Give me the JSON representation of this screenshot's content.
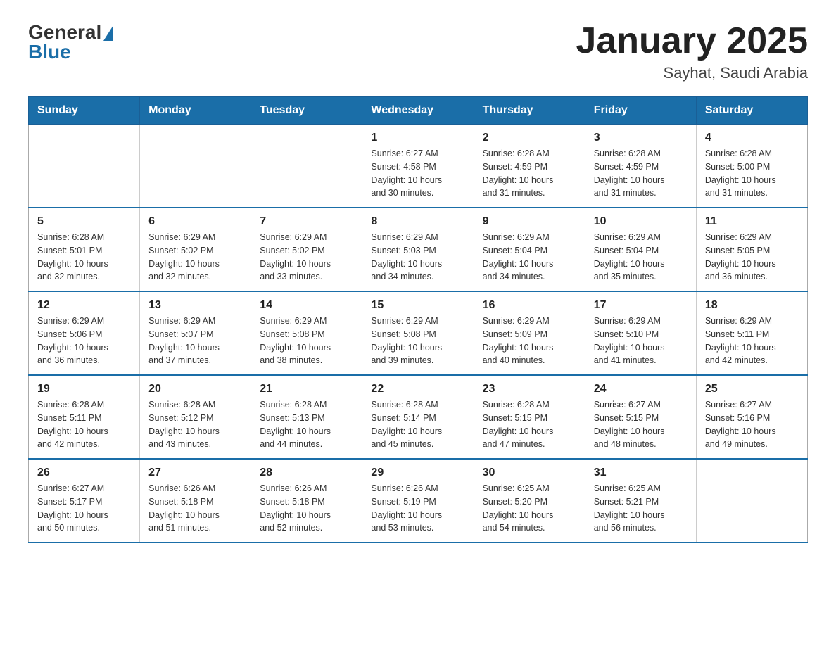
{
  "header": {
    "logo_general": "General",
    "logo_blue": "Blue",
    "title": "January 2025",
    "subtitle": "Sayhat, Saudi Arabia"
  },
  "weekdays": [
    "Sunday",
    "Monday",
    "Tuesday",
    "Wednesday",
    "Thursday",
    "Friday",
    "Saturday"
  ],
  "weeks": [
    [
      {
        "day": null,
        "info": null
      },
      {
        "day": null,
        "info": null
      },
      {
        "day": null,
        "info": null
      },
      {
        "day": "1",
        "info": "Sunrise: 6:27 AM\nSunset: 4:58 PM\nDaylight: 10 hours\nand 30 minutes."
      },
      {
        "day": "2",
        "info": "Sunrise: 6:28 AM\nSunset: 4:59 PM\nDaylight: 10 hours\nand 31 minutes."
      },
      {
        "day": "3",
        "info": "Sunrise: 6:28 AM\nSunset: 4:59 PM\nDaylight: 10 hours\nand 31 minutes."
      },
      {
        "day": "4",
        "info": "Sunrise: 6:28 AM\nSunset: 5:00 PM\nDaylight: 10 hours\nand 31 minutes."
      }
    ],
    [
      {
        "day": "5",
        "info": "Sunrise: 6:28 AM\nSunset: 5:01 PM\nDaylight: 10 hours\nand 32 minutes."
      },
      {
        "day": "6",
        "info": "Sunrise: 6:29 AM\nSunset: 5:02 PM\nDaylight: 10 hours\nand 32 minutes."
      },
      {
        "day": "7",
        "info": "Sunrise: 6:29 AM\nSunset: 5:02 PM\nDaylight: 10 hours\nand 33 minutes."
      },
      {
        "day": "8",
        "info": "Sunrise: 6:29 AM\nSunset: 5:03 PM\nDaylight: 10 hours\nand 34 minutes."
      },
      {
        "day": "9",
        "info": "Sunrise: 6:29 AM\nSunset: 5:04 PM\nDaylight: 10 hours\nand 34 minutes."
      },
      {
        "day": "10",
        "info": "Sunrise: 6:29 AM\nSunset: 5:04 PM\nDaylight: 10 hours\nand 35 minutes."
      },
      {
        "day": "11",
        "info": "Sunrise: 6:29 AM\nSunset: 5:05 PM\nDaylight: 10 hours\nand 36 minutes."
      }
    ],
    [
      {
        "day": "12",
        "info": "Sunrise: 6:29 AM\nSunset: 5:06 PM\nDaylight: 10 hours\nand 36 minutes."
      },
      {
        "day": "13",
        "info": "Sunrise: 6:29 AM\nSunset: 5:07 PM\nDaylight: 10 hours\nand 37 minutes."
      },
      {
        "day": "14",
        "info": "Sunrise: 6:29 AM\nSunset: 5:08 PM\nDaylight: 10 hours\nand 38 minutes."
      },
      {
        "day": "15",
        "info": "Sunrise: 6:29 AM\nSunset: 5:08 PM\nDaylight: 10 hours\nand 39 minutes."
      },
      {
        "day": "16",
        "info": "Sunrise: 6:29 AM\nSunset: 5:09 PM\nDaylight: 10 hours\nand 40 minutes."
      },
      {
        "day": "17",
        "info": "Sunrise: 6:29 AM\nSunset: 5:10 PM\nDaylight: 10 hours\nand 41 minutes."
      },
      {
        "day": "18",
        "info": "Sunrise: 6:29 AM\nSunset: 5:11 PM\nDaylight: 10 hours\nand 42 minutes."
      }
    ],
    [
      {
        "day": "19",
        "info": "Sunrise: 6:28 AM\nSunset: 5:11 PM\nDaylight: 10 hours\nand 42 minutes."
      },
      {
        "day": "20",
        "info": "Sunrise: 6:28 AM\nSunset: 5:12 PM\nDaylight: 10 hours\nand 43 minutes."
      },
      {
        "day": "21",
        "info": "Sunrise: 6:28 AM\nSunset: 5:13 PM\nDaylight: 10 hours\nand 44 minutes."
      },
      {
        "day": "22",
        "info": "Sunrise: 6:28 AM\nSunset: 5:14 PM\nDaylight: 10 hours\nand 45 minutes."
      },
      {
        "day": "23",
        "info": "Sunrise: 6:28 AM\nSunset: 5:15 PM\nDaylight: 10 hours\nand 47 minutes."
      },
      {
        "day": "24",
        "info": "Sunrise: 6:27 AM\nSunset: 5:15 PM\nDaylight: 10 hours\nand 48 minutes."
      },
      {
        "day": "25",
        "info": "Sunrise: 6:27 AM\nSunset: 5:16 PM\nDaylight: 10 hours\nand 49 minutes."
      }
    ],
    [
      {
        "day": "26",
        "info": "Sunrise: 6:27 AM\nSunset: 5:17 PM\nDaylight: 10 hours\nand 50 minutes."
      },
      {
        "day": "27",
        "info": "Sunrise: 6:26 AM\nSunset: 5:18 PM\nDaylight: 10 hours\nand 51 minutes."
      },
      {
        "day": "28",
        "info": "Sunrise: 6:26 AM\nSunset: 5:18 PM\nDaylight: 10 hours\nand 52 minutes."
      },
      {
        "day": "29",
        "info": "Sunrise: 6:26 AM\nSunset: 5:19 PM\nDaylight: 10 hours\nand 53 minutes."
      },
      {
        "day": "30",
        "info": "Sunrise: 6:25 AM\nSunset: 5:20 PM\nDaylight: 10 hours\nand 54 minutes."
      },
      {
        "day": "31",
        "info": "Sunrise: 6:25 AM\nSunset: 5:21 PM\nDaylight: 10 hours\nand 56 minutes."
      },
      {
        "day": null,
        "info": null
      }
    ]
  ]
}
